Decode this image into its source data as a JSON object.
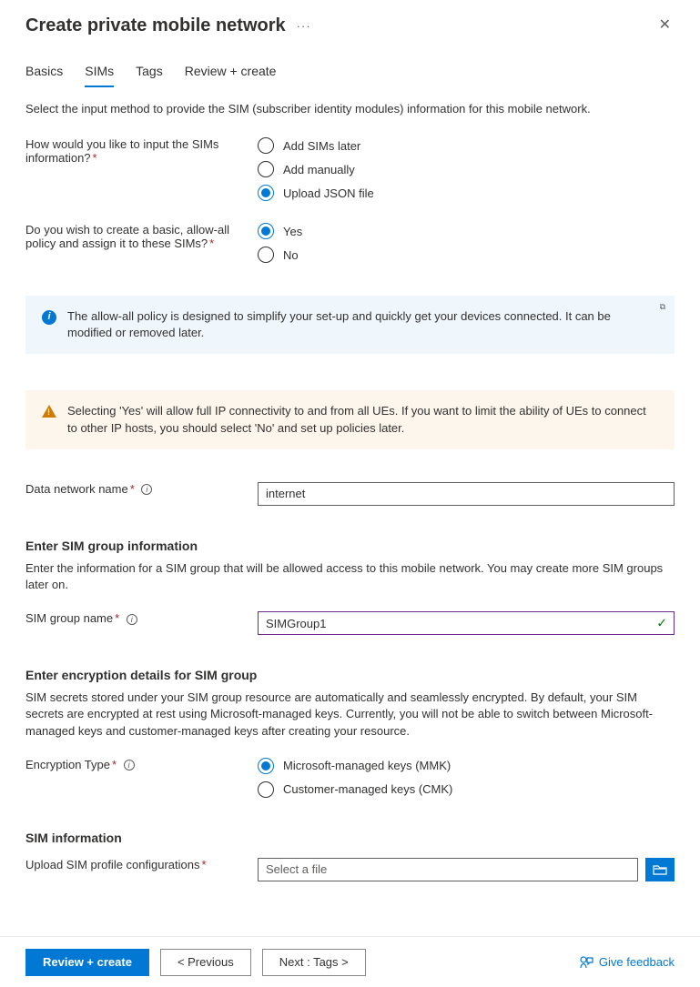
{
  "header": {
    "title": "Create private mobile network"
  },
  "tabs": {
    "basics": "Basics",
    "sims": "SIMs",
    "tags": "Tags",
    "review": "Review + create",
    "active": "sims"
  },
  "intro": "Select the input method to provide the SIM (subscriber identity modules) information for this mobile network.",
  "input_method": {
    "label": "How would you like to input the SIMs information?",
    "options": {
      "later": "Add SIMs later",
      "manual": "Add manually",
      "json": "Upload JSON file"
    },
    "selected": "json"
  },
  "allow_all": {
    "label": "Do you wish to create a basic, allow-all policy and assign it to these SIMs?",
    "options": {
      "yes": "Yes",
      "no": "No"
    },
    "selected": "yes"
  },
  "info_callout": "The allow-all policy is designed to simplify your set-up and quickly get your devices connected. It can be modified or removed later.",
  "warn_callout": "Selecting 'Yes' will allow full IP connectivity to and from all UEs. If you want to limit the ability of UEs to connect to other IP hosts, you should select 'No' and set up policies later.",
  "data_network": {
    "label": "Data network name",
    "value": "internet"
  },
  "sim_group": {
    "title": "Enter SIM group information",
    "desc": "Enter the information for a SIM group that will be allowed access to this mobile network. You may create more SIM groups later on.",
    "name_label": "SIM group name",
    "name_value": "SIMGroup1"
  },
  "encryption": {
    "title": "Enter encryption details for SIM group",
    "desc": "SIM secrets stored under your SIM group resource are automatically and seamlessly encrypted. By default, your SIM secrets are encrypted at rest using Microsoft-managed keys. Currently, you will not be able to switch between Microsoft-managed keys and customer-managed keys after creating your resource.",
    "type_label": "Encryption Type",
    "options": {
      "mmk": "Microsoft-managed keys (MMK)",
      "cmk": "Customer-managed keys (CMK)"
    },
    "selected": "mmk"
  },
  "sim_info": {
    "title": "SIM information",
    "upload_label": "Upload SIM profile configurations",
    "placeholder": "Select a file"
  },
  "footer": {
    "review": "Review + create",
    "previous": "< Previous",
    "next": "Next : Tags >",
    "feedback": "Give feedback"
  }
}
